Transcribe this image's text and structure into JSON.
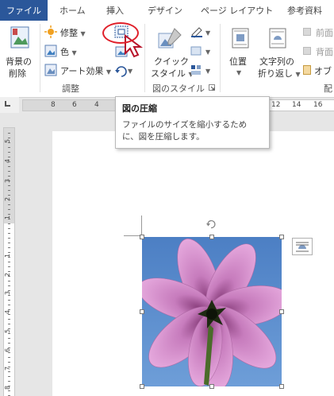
{
  "tabs": {
    "file": "ファイル",
    "home": "ホーム",
    "insert": "挿入",
    "design": "デザイン",
    "page_layout": "ページ レイアウト",
    "references": "参考資料"
  },
  "ribbon": {
    "remove_background_line1": "背景の",
    "remove_background_line2": "削除",
    "corrections": "修整",
    "color": "色",
    "artistic_effects": "アート効果",
    "group_adjust": "調整",
    "quick_styles_line1": "クイック",
    "quick_styles_line2": "スタイル",
    "group_picture_styles": "図のスタイル",
    "position": "位置",
    "wrap_text_line1": "文字列の",
    "wrap_text_line2": "折り返し",
    "bring_forward": "前面",
    "send_backward": "背面",
    "selection_pane": "オブ",
    "group_arrange": "配"
  },
  "ruler": {
    "horizontal": [
      "8",
      "6",
      "4",
      "12",
      "14",
      "16"
    ],
    "vertical": [
      "5",
      "4",
      "3",
      "2",
      "1",
      "1",
      "2",
      "3",
      "4",
      "5",
      "6",
      "7",
      "8",
      "9"
    ]
  },
  "tooltip": {
    "title": "図の圧縮",
    "description": "ファイルのサイズを縮小するために、図を圧縮します。"
  },
  "colors": {
    "accent": "#2b579a",
    "highlight": "#e0202a",
    "sky": "#4d87cc",
    "petal": "#d98fcf"
  }
}
